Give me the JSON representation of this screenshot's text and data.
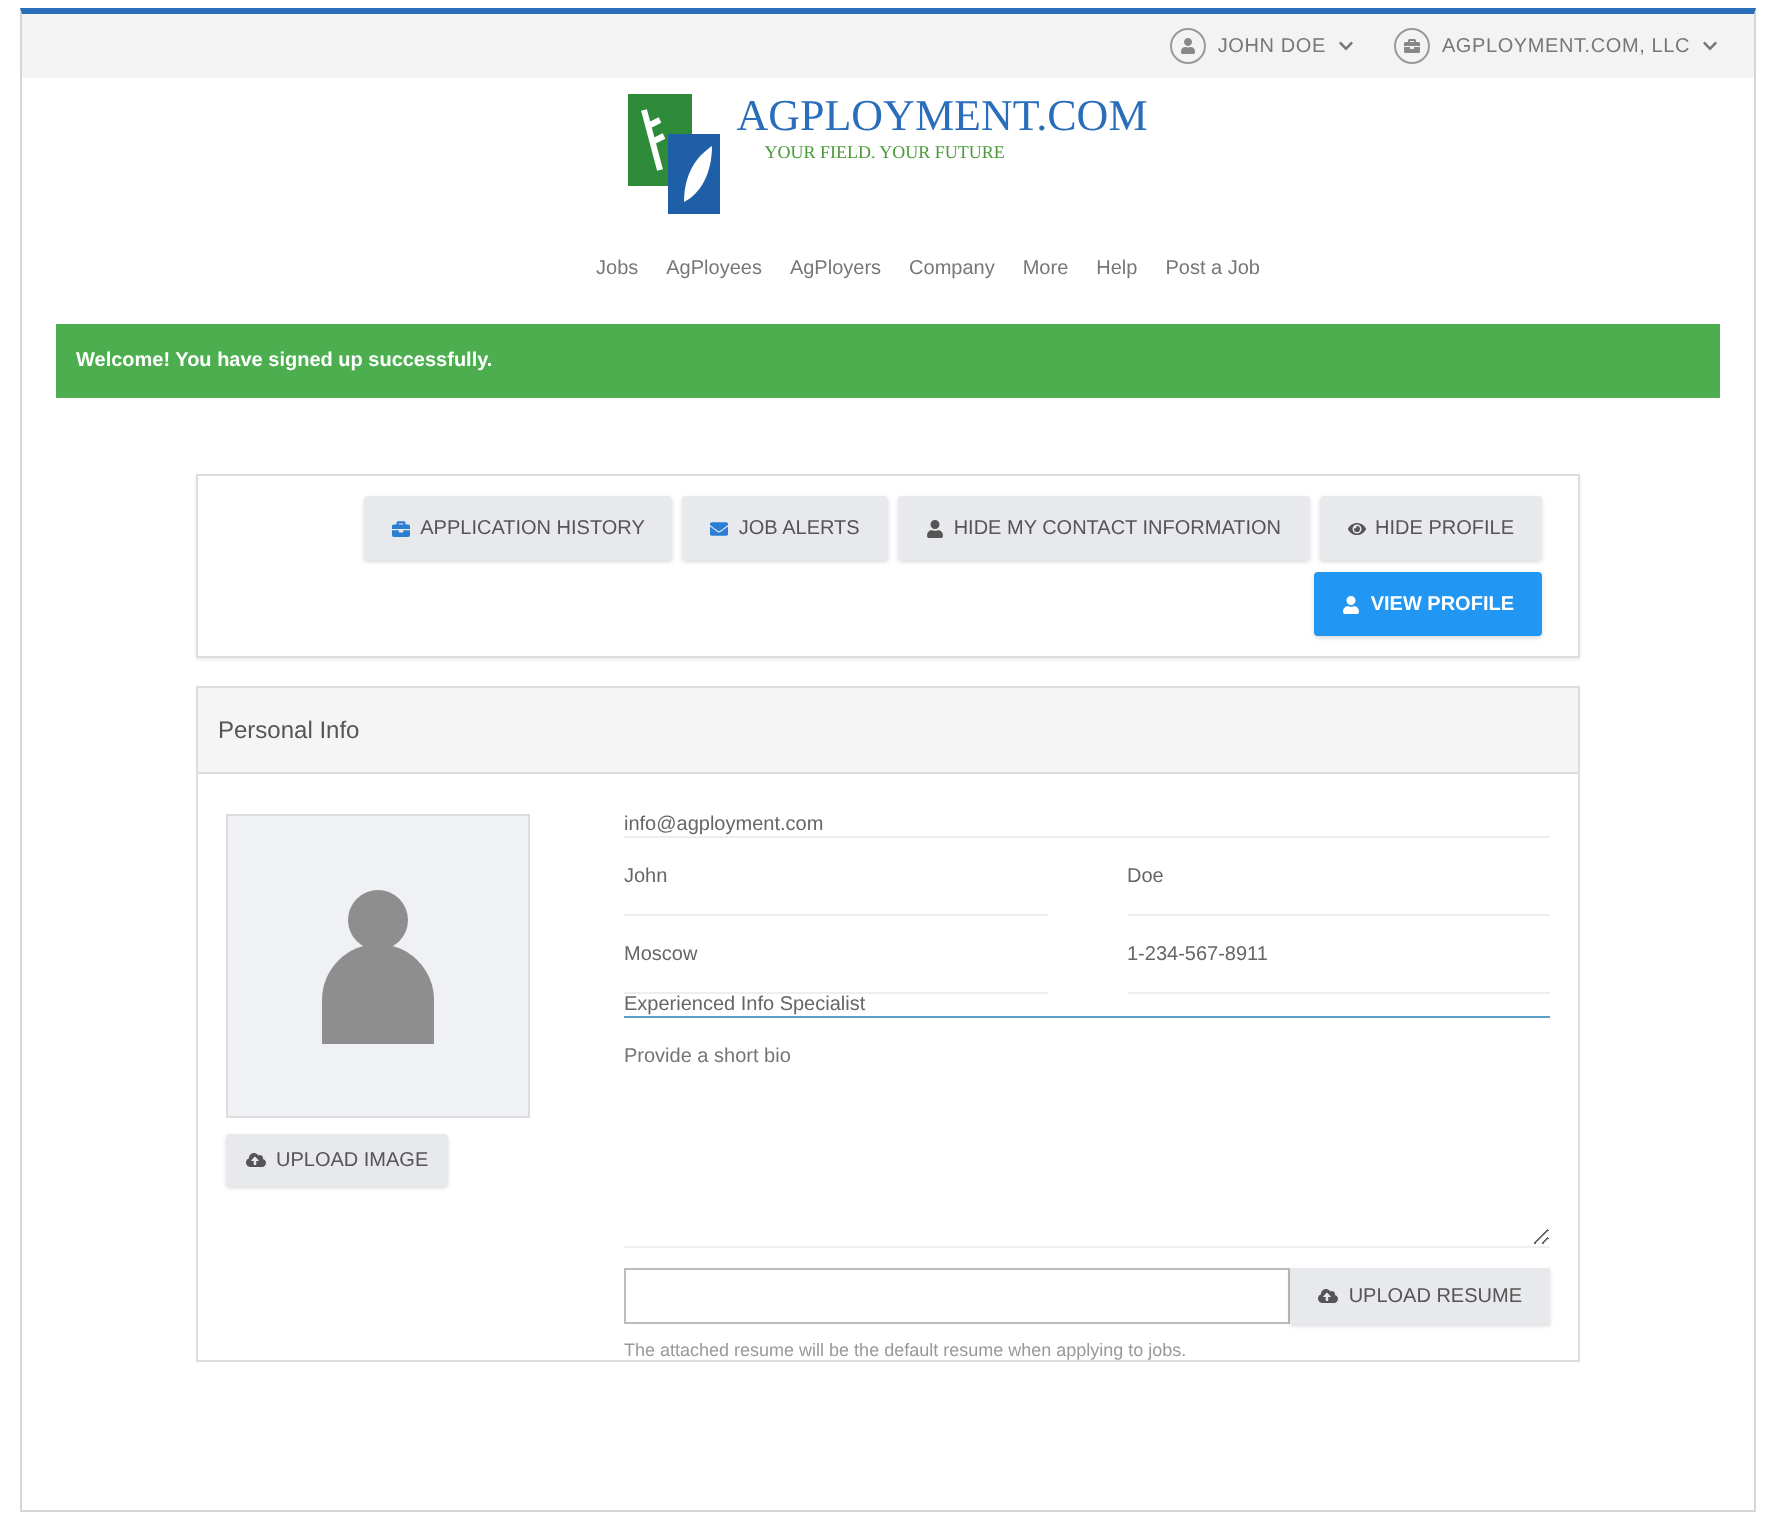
{
  "top_bar": {
    "user_menu": "JOHN DOE",
    "company_menu": "AGPLOYMENT.COM, LLC"
  },
  "logo": {
    "name": "AGPLOYMENT.COM",
    "tagline": "YOUR FIELD. YOUR FUTURE"
  },
  "nav": [
    "Jobs",
    "AgPloyees",
    "AgPloyers",
    "Company",
    "More",
    "Help",
    "Post a Job"
  ],
  "alert": "Welcome! You have signed up successfully.",
  "actions": [
    {
      "label": "APPLICATION HISTORY",
      "kind": "history",
      "primary": false
    },
    {
      "label": "JOB ALERTS",
      "kind": "alerts",
      "primary": false
    },
    {
      "label": "HIDE MY CONTACT INFORMATION",
      "kind": "contact",
      "primary": false
    },
    {
      "label": "HIDE PROFILE",
      "kind": "visibility",
      "primary": false
    },
    {
      "label": "VIEW PROFILE",
      "kind": "profile",
      "primary": true
    }
  ],
  "personal_info": {
    "title": "Personal Info",
    "upload_image": "UPLOAD IMAGE",
    "email": "info@agployment.com",
    "first_name": "John",
    "last_name": "Doe",
    "city": "Moscow",
    "phone": "1-234-567-8911",
    "headline": {
      "value": "Experienced Info Specialist",
      "focused": true
    },
    "bio": {
      "placeholder": "Provide a short bio"
    },
    "upload_resume": "UPLOAD RESUME",
    "resume_help": "The attached resume will be the default resume when applying to jobs."
  }
}
